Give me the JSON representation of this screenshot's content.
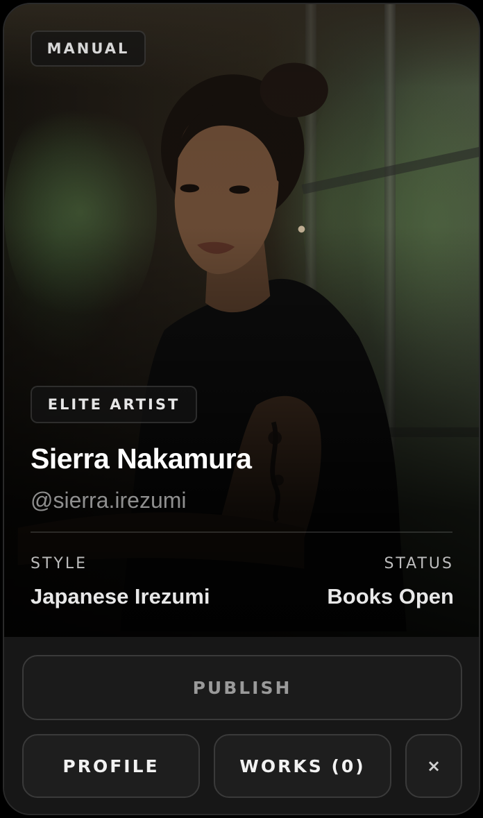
{
  "card": {
    "top_badge": "MANUAL",
    "tier_badge": "ELITE ARTIST",
    "name": "Sierra Nakamura",
    "handle": "@sierra.irezumi",
    "style_label": "STYLE",
    "style_value": "Japanese Irezumi",
    "status_label": "STATUS",
    "status_value": "Books Open",
    "photo_icon": "portrait-photo"
  },
  "actions": {
    "publish_label": "PUBLISH",
    "profile_label": "PROFILE",
    "works_label": "WORKS (0)",
    "close_label": "×",
    "close_icon": "close-icon"
  }
}
